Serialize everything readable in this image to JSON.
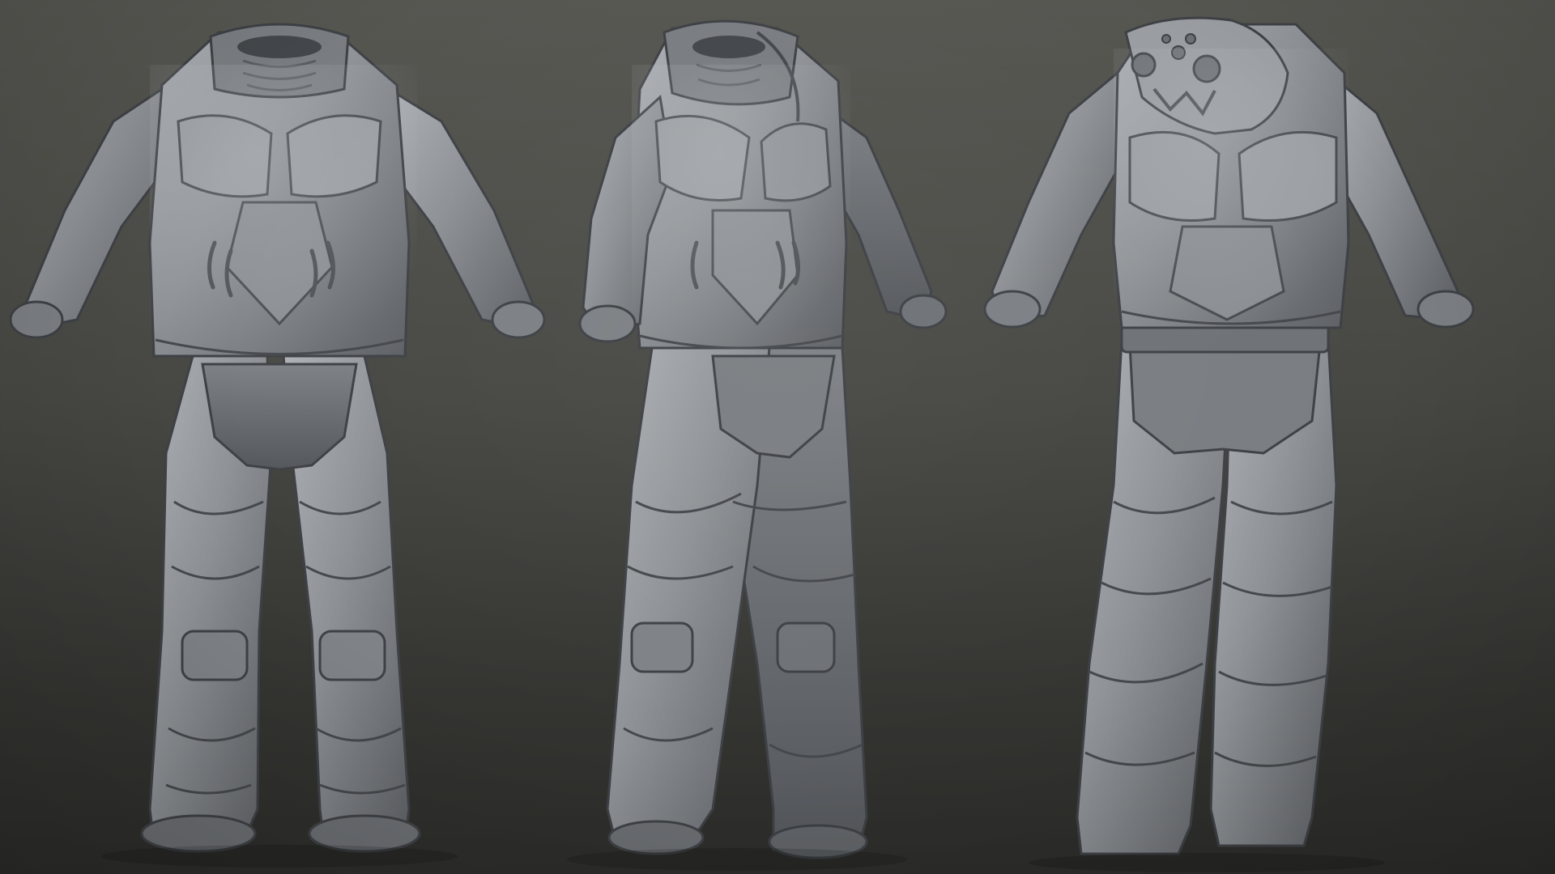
{
  "scene": {
    "background_top": "#575752",
    "background_bottom": "#2c2c2a",
    "material_color": "#8e9296",
    "material_shadow": "#4f5256",
    "material_highlight": "#b4b8bc",
    "views": [
      {
        "id": "front",
        "icon": "suit-front-view"
      },
      {
        "id": "three-quarter",
        "icon": "suit-three-quarter-view"
      },
      {
        "id": "back",
        "icon": "suit-back-view"
      }
    ]
  }
}
